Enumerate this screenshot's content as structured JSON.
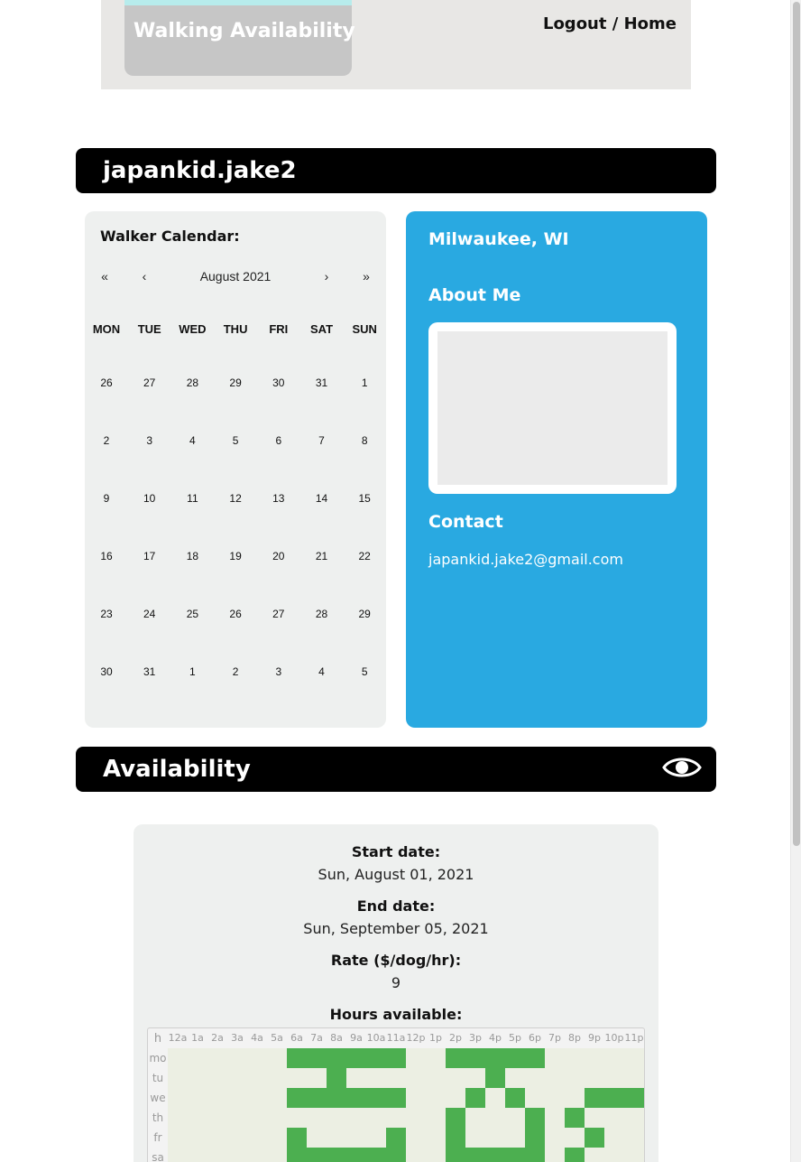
{
  "header": {
    "tab_title": "Walking Availability",
    "logout_label": "Logout",
    "separator": " / ",
    "home_label": "Home",
    "accent_strip_color": "#b7ecec"
  },
  "profile": {
    "username": "japankid.jake2"
  },
  "calendar": {
    "heading": "Walker Calendar:",
    "prev_year": "«",
    "prev_month": "‹",
    "month_label": "August 2021",
    "next_month": "›",
    "next_year": "»",
    "weekdays": [
      "MON",
      "TUE",
      "WED",
      "THU",
      "FRI",
      "SAT",
      "SUN"
    ],
    "weeks": [
      [
        "26",
        "27",
        "28",
        "29",
        "30",
        "31",
        "1"
      ],
      [
        "2",
        "3",
        "4",
        "5",
        "6",
        "7",
        "8"
      ],
      [
        "9",
        "10",
        "11",
        "12",
        "13",
        "14",
        "15"
      ],
      [
        "16",
        "17",
        "18",
        "19",
        "20",
        "21",
        "22"
      ],
      [
        "23",
        "24",
        "25",
        "26",
        "27",
        "28",
        "29"
      ],
      [
        "30",
        "31",
        "1",
        "2",
        "3",
        "4",
        "5"
      ]
    ]
  },
  "info": {
    "location": "Milwaukee, WI",
    "about_heading": "About Me",
    "about_text": "",
    "contact_heading": "Contact",
    "email": "japankid.jake2@gmail.com",
    "panel_color": "#29a9e1"
  },
  "availability": {
    "heading": "Availability",
    "start_label": "Start date:",
    "start_value": "Sun, August 01, 2021",
    "end_label": "End date:",
    "end_value": "Sun, September 05, 2021",
    "rate_label": "Rate ($/dog/hr):",
    "rate_value": "9",
    "hours_label": "Hours available:",
    "hours_corner": "h",
    "hour_labels": [
      "12a",
      "1a",
      "2a",
      "3a",
      "4a",
      "5a",
      "6a",
      "7a",
      "8a",
      "9a",
      "10a",
      "11a",
      "12p",
      "1p",
      "2p",
      "3p",
      "4p",
      "5p",
      "6p",
      "7p",
      "8p",
      "9p",
      "10p",
      "11p"
    ],
    "day_labels": [
      "mo",
      "tu",
      "we",
      "th",
      "fr",
      "sa"
    ],
    "available_color": "#4caf50",
    "grid": [
      [
        0,
        0,
        0,
        0,
        0,
        0,
        1,
        1,
        1,
        1,
        1,
        1,
        0,
        0,
        1,
        1,
        1,
        1,
        1,
        0,
        0,
        0,
        0,
        0
      ],
      [
        0,
        0,
        0,
        0,
        0,
        0,
        0,
        0,
        1,
        0,
        0,
        0,
        0,
        0,
        0,
        0,
        1,
        0,
        0,
        0,
        0,
        0,
        0,
        0
      ],
      [
        0,
        0,
        0,
        0,
        0,
        0,
        1,
        1,
        1,
        1,
        1,
        1,
        0,
        0,
        0,
        1,
        0,
        1,
        0,
        0,
        0,
        1,
        1,
        1
      ],
      [
        0,
        0,
        0,
        0,
        0,
        0,
        0,
        0,
        0,
        0,
        0,
        0,
        0,
        0,
        1,
        0,
        0,
        0,
        1,
        0,
        1,
        0,
        0,
        0
      ],
      [
        0,
        0,
        0,
        0,
        0,
        0,
        1,
        0,
        0,
        0,
        0,
        1,
        0,
        0,
        1,
        0,
        0,
        0,
        1,
        0,
        0,
        1,
        0,
        0
      ],
      [
        0,
        0,
        0,
        0,
        0,
        0,
        1,
        1,
        1,
        1,
        1,
        1,
        0,
        0,
        1,
        1,
        1,
        1,
        1,
        0,
        1,
        0,
        0,
        0
      ]
    ]
  }
}
